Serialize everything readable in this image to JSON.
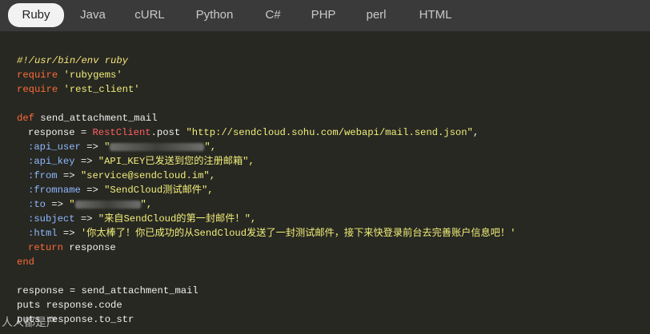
{
  "tabs": [
    {
      "label": "Ruby",
      "active": true
    },
    {
      "label": "Java",
      "active": false
    },
    {
      "label": "cURL",
      "active": false
    },
    {
      "label": "Python",
      "active": false
    },
    {
      "label": "C#",
      "active": false
    },
    {
      "label": "PHP",
      "active": false
    },
    {
      "label": "perl",
      "active": false
    },
    {
      "label": "HTML",
      "active": false
    }
  ],
  "code": {
    "shebang": "#!/usr/bin/env ruby",
    "require_kw": "require",
    "lib_rubygems": "'rubygems'",
    "lib_rest_client": "'rest_client'",
    "def_kw": "def",
    "method_name": " send_attachment_mail",
    "response_assign": "response = ",
    "restclient_const": "RestClient",
    "post_call": ".post ",
    "url": "\"http://sendcloud.sohu.com/webapi/mail.send.json\"",
    "comma": ",",
    "sym_api_user": ":api_user",
    "sym_api_key": ":api_key",
    "sym_from": ":from",
    "sym_fromname": ":fromname",
    "sym_to": ":to",
    "sym_subject": ":subject",
    "sym_html": ":html",
    "arrow": " => ",
    "quote_open": "\"",
    "quote_close_comma": "\",",
    "val_api_key": "\"API_KEY已发送到您的注册邮箱\",",
    "val_from": "\"service@sendcloud.im\",",
    "val_fromname": "\"SendCloud测试邮件\",",
    "val_subject": "\"来自SendCloud的第一封邮件！\",",
    "val_html": "'你太棒了！你已成功的从SendCloud发送了一封测试邮件，接下来快登录前台去完善账户信息吧！'",
    "return_kw": "return",
    "return_val": " response",
    "end_kw": "end",
    "call_line": "response = send_attachment_mail",
    "puts_code": "puts response.code",
    "puts_str": "puts response.to_str"
  },
  "watermark": "人人都是产"
}
